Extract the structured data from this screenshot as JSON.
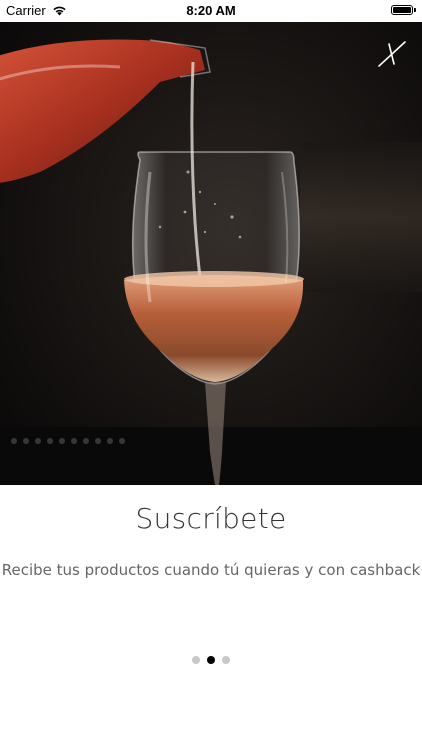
{
  "status_bar": {
    "carrier": "Carrier",
    "time": "8:20 AM",
    "wifi_icon": "wifi-icon",
    "battery_icon": "battery-icon",
    "battery_level": 1.0
  },
  "hero": {
    "image_subject": "wine-being-poured-into-glass",
    "close_icon": "close-icon"
  },
  "onboarding": {
    "title": "Suscríbete",
    "subtitle": "Recibe tus productos cuando tú quieras y con cashback"
  },
  "pagination": {
    "total_pages": 3,
    "current_page": 2
  },
  "colors": {
    "title_text": "#333333",
    "subtitle_text": "#666666",
    "dot_active": "#000000",
    "dot_inactive": "#c8c8c8",
    "wine": "#b8603a"
  }
}
